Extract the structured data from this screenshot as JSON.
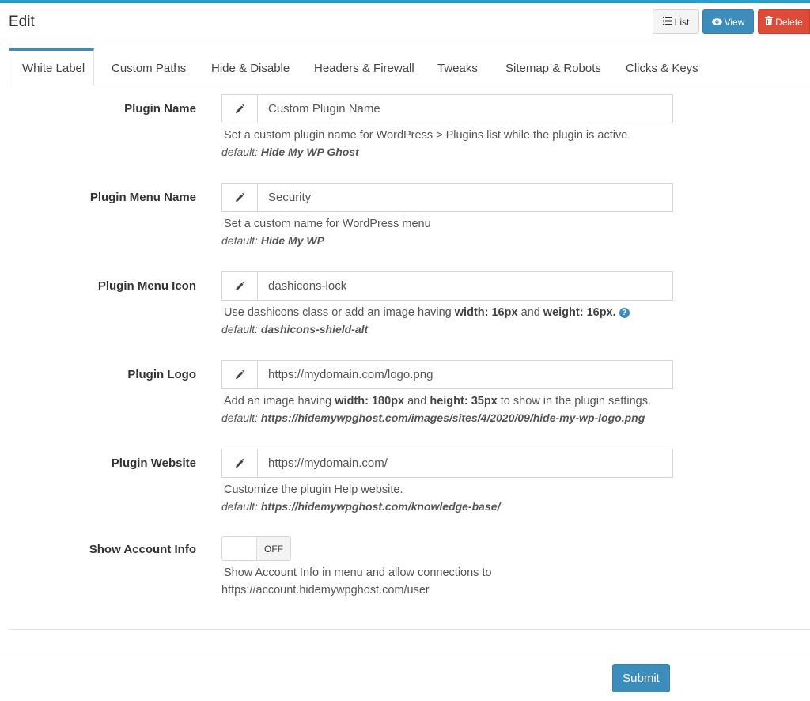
{
  "header": {
    "title": "Edit",
    "buttons": {
      "list": "List",
      "view": "View",
      "delete": "Delete"
    }
  },
  "tabs": [
    {
      "label": "White Label",
      "active": true
    },
    {
      "label": "Custom Paths"
    },
    {
      "label": "Hide & Disable"
    },
    {
      "label": "Headers & Firewall"
    },
    {
      "label": "Tweaks"
    },
    {
      "label": "Sitemap & Robots"
    },
    {
      "label": "Clicks & Keys"
    }
  ],
  "form": {
    "plugin_name": {
      "label": "Plugin Name",
      "value": "Custom Plugin Name",
      "help": "Set a custom plugin name for WordPress > Plugins list while the plugin is active",
      "default_label": "default:",
      "default_value": "Hide My WP Ghost"
    },
    "menu_name": {
      "label": "Plugin Menu Name",
      "value": "Security",
      "help": "Set a custom name for WordPress menu",
      "default_label": "default:",
      "default_value": "Hide My WP"
    },
    "menu_icon": {
      "label": "Plugin Menu Icon",
      "value": "dashicons-lock",
      "help_1": "Use dashicons class or add an image having ",
      "help_b1": "width: 16px",
      "help_2": " and ",
      "help_b2": "weight: 16px.",
      "help_icon": "?",
      "default_label": "default:",
      "default_value": "dashicons-shield-alt"
    },
    "logo": {
      "label": "Plugin Logo",
      "value": "https://mydomain.com/logo.png",
      "help_1": "Add an image having ",
      "help_b1": "width: 180px",
      "help_2": " and ",
      "help_b2": "height: 35px",
      "help_3": " to show in the plugin settings.",
      "default_label": "default:",
      "default_value": "https://hidemywpghost.com/images/sites/4/2020/09/hide-my-wp-logo.png"
    },
    "website": {
      "label": "Plugin Website",
      "value": "https://mydomain.com/",
      "help": "Customize the plugin Help website.",
      "default_label": "default:",
      "default_value": "https://hidemywpghost.com/knowledge-base/"
    },
    "account_info": {
      "label": "Show Account Info",
      "toggle_state": "OFF",
      "help_line1": "Show Account Info in menu and allow connections to",
      "help_line2": "https://account.hidemywpghost.com/user"
    }
  },
  "submit_label": "Submit",
  "colors": {
    "accent": "#3c8dbc",
    "danger": "#dd4b39",
    "top_bar": "#29a0c7"
  },
  "icons": {
    "list": "list-icon",
    "view": "eye-icon",
    "delete": "trash-icon",
    "field": "pencil-icon"
  }
}
